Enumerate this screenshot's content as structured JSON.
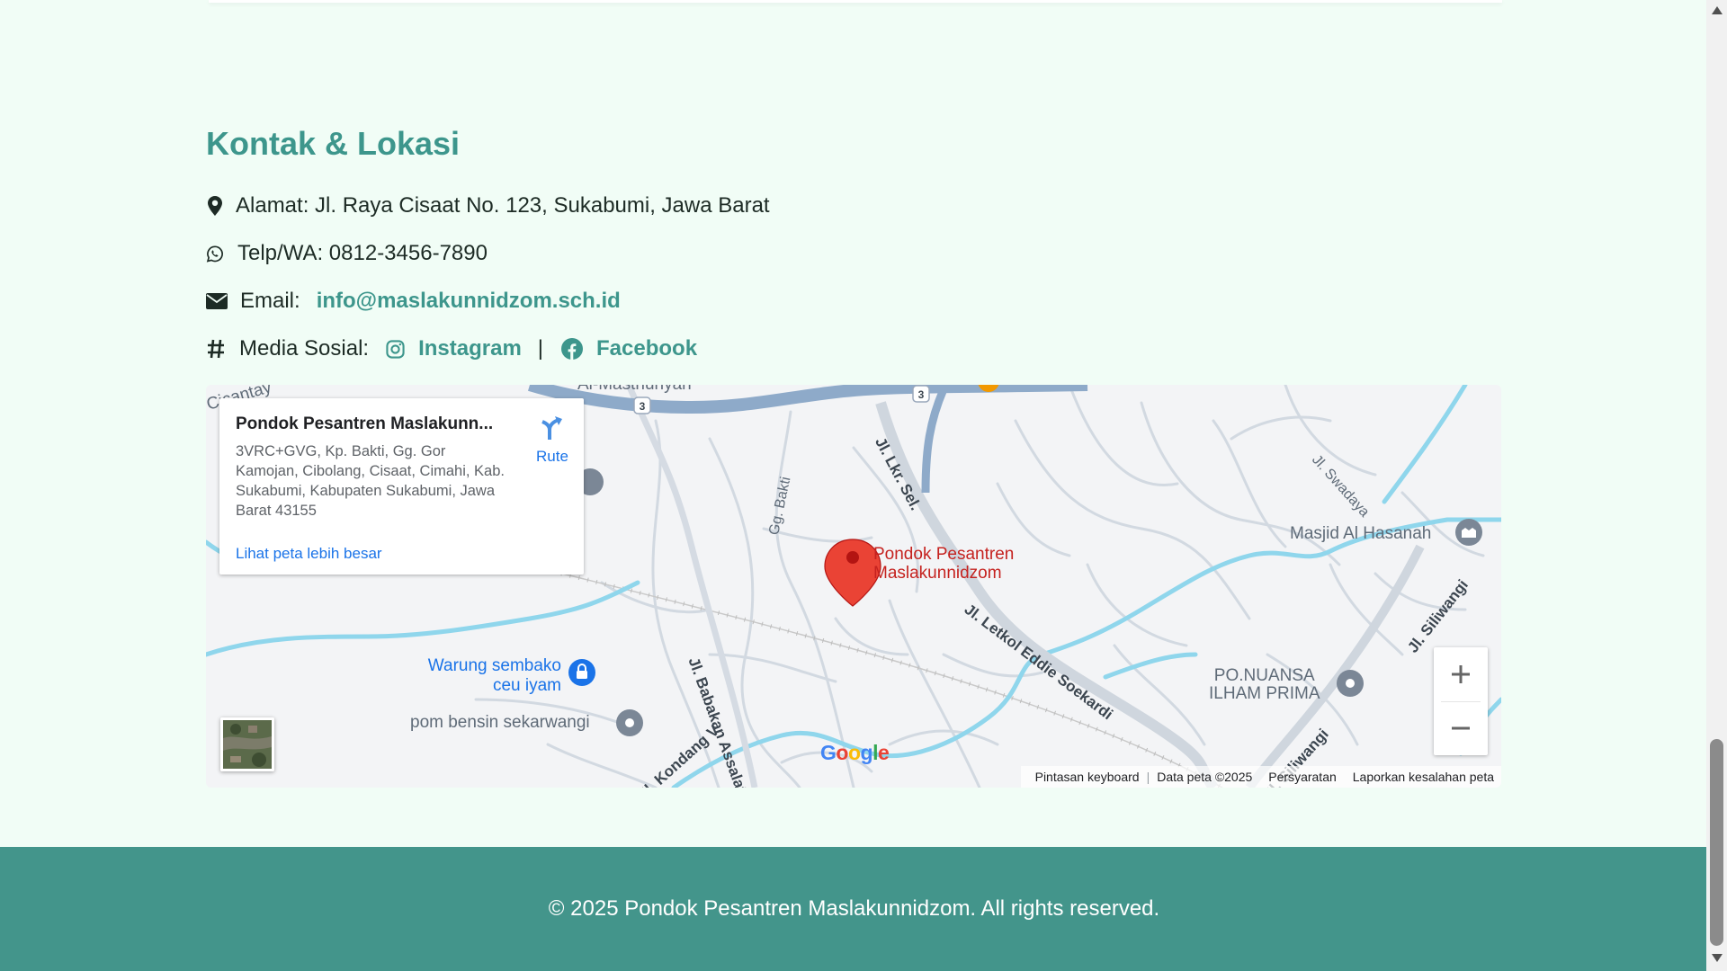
{
  "contact": {
    "title": "Kontak & Lokasi",
    "address_text": "Alamat: Jl. Raya Cisaat No. 123, Sukabumi, Jawa Barat",
    "phone_text": "Telp/WA: 0812-3456-7890",
    "email_label": "Email:",
    "email_value": "info@maslakunnidzom.sch.id",
    "social_label": "Media Sosial:",
    "instagram_label": "Instagram",
    "separator": "|",
    "facebook_label": "Facebook"
  },
  "map": {
    "info_card": {
      "title": "Pondok Pesantren Maslakunn...",
      "address": "3VRC+GVG, Kp. Bakti, Gg. Gor Kamojan, Cibolang, Cisaat, Cimahi, Kab. Sukabumi, Kabupaten Sukabumi, Jawa Barat 43155",
      "larger_map_link": "Lihat peta lebih besar",
      "route_label": "Rute"
    },
    "pin_label_line1": "Pondok Pesantren",
    "pin_label_line2": "Maslakunnidzom",
    "places": {
      "masjid": "Masjid Al Hasanah",
      "warung_line1": "Warung sembako",
      "warung_line2": "ceu iyam",
      "pom": "pom bensin sekarwangi",
      "nuansa_line1": "PO.NUANSA",
      "nuansa_line2": "ILHAM PRIMA",
      "almasthuriyah": "Al-Masthuriyah",
      "cicantayan": "Cicantay"
    },
    "streets": {
      "lkr_sel": "Jl. Lkr. Sel.",
      "gg_bakti": "Gg. Bakti",
      "swadaya": "Jl. Swadaya",
      "siliwangi": "Jl. Siliwangi",
      "siliwangi_2": "Jl. Siliwangi",
      "letkol": "Jl. Letkol Eddie Soekardi",
      "babakan": "Jl. Babakan Assalafi",
      "kondang": "Jl. Kondang V"
    },
    "route_shield": "3",
    "google_logo": "Google",
    "attribution": {
      "keyboard": "Pintasan keyboard",
      "data": "Data peta ©2025",
      "terms": "Persyaratan",
      "report": "Laporkan kesalahan peta"
    },
    "colors": {
      "water": "#8fd6ec",
      "highway": "#8eaac9",
      "pin": "#ea4335"
    }
  },
  "footer": {
    "text": "© 2025 Pondok Pesantren Maslakunnidzom. All rights reserved."
  },
  "colors": {
    "accent": "#3d968c",
    "footer_bg": "#43958b",
    "page_bg": "#f1fdf6"
  }
}
